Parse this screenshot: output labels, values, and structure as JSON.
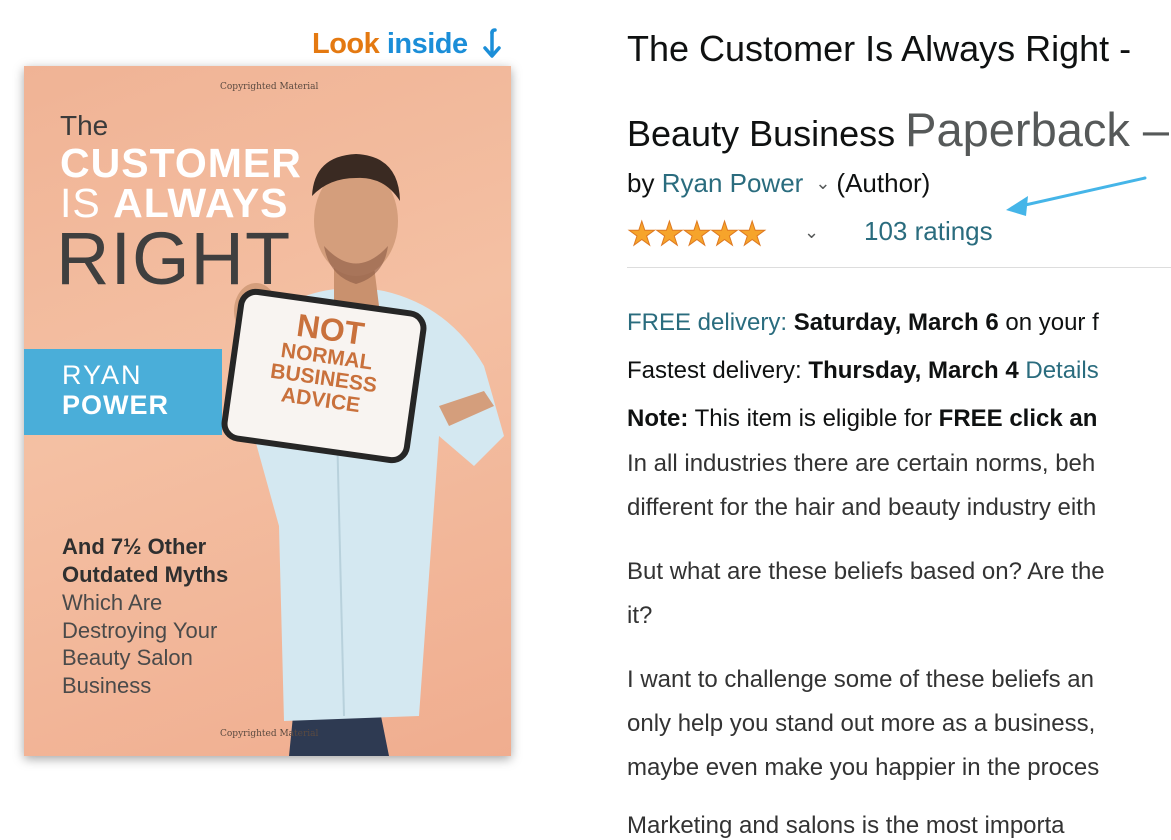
{
  "look_inside": {
    "word1": "Look",
    "word2": "inside"
  },
  "cover": {
    "copyright_top": "Copyrighted Material",
    "copyright_bottom": "Copyrighted Material",
    "the": "The",
    "customer": "CUSTOMER",
    "is": "IS",
    "always": "ALWAYS",
    "right": "RIGHT",
    "author_first": "RYAN",
    "author_last": "POWER",
    "sign": [
      "NOT",
      "NORMAL",
      "BUSINESS",
      "ADVICE"
    ],
    "tagline": [
      "And 7½ Other",
      "Outdated Myths",
      "Which Are",
      "Destroying Your",
      "Beauty Salon",
      "Business"
    ]
  },
  "product": {
    "title_line1": "The Customer Is Always Right - ",
    "title_line2": "Beauty Business ",
    "format": "Paperback –",
    "by": "by",
    "author": "Ryan Power",
    "role": "(Author)",
    "stars": "★★★★★",
    "rating_value": 5,
    "ratings_count": "103 ratings"
  },
  "delivery": {
    "free_label": "FREE delivery:",
    "free_date": "Saturday, March 6",
    "free_rest": "on your f",
    "fastest_label": "Fastest delivery:",
    "fastest_date": "Thursday, March 4",
    "details_link": "Details",
    "note_label": "Note:",
    "note_text": "This item is eligible for",
    "note_bold": "FREE click an"
  },
  "description": [
    "In all industries there are certain norms, beh",
    "different for the hair and beauty industry eith",
    "But what are these beliefs based on? Are the",
    "it?",
    "I want to challenge some of these beliefs an",
    "only help you stand out more as a business,",
    "maybe even make you happier in the proces",
    "Marketing and salons is the most importa"
  ],
  "colors": {
    "link": "#2a6c7e",
    "star": "#f6a42b",
    "look_orange": "#e47911",
    "look_blue": "#1b8ed8",
    "annotation_arrow": "#45b5e8"
  }
}
